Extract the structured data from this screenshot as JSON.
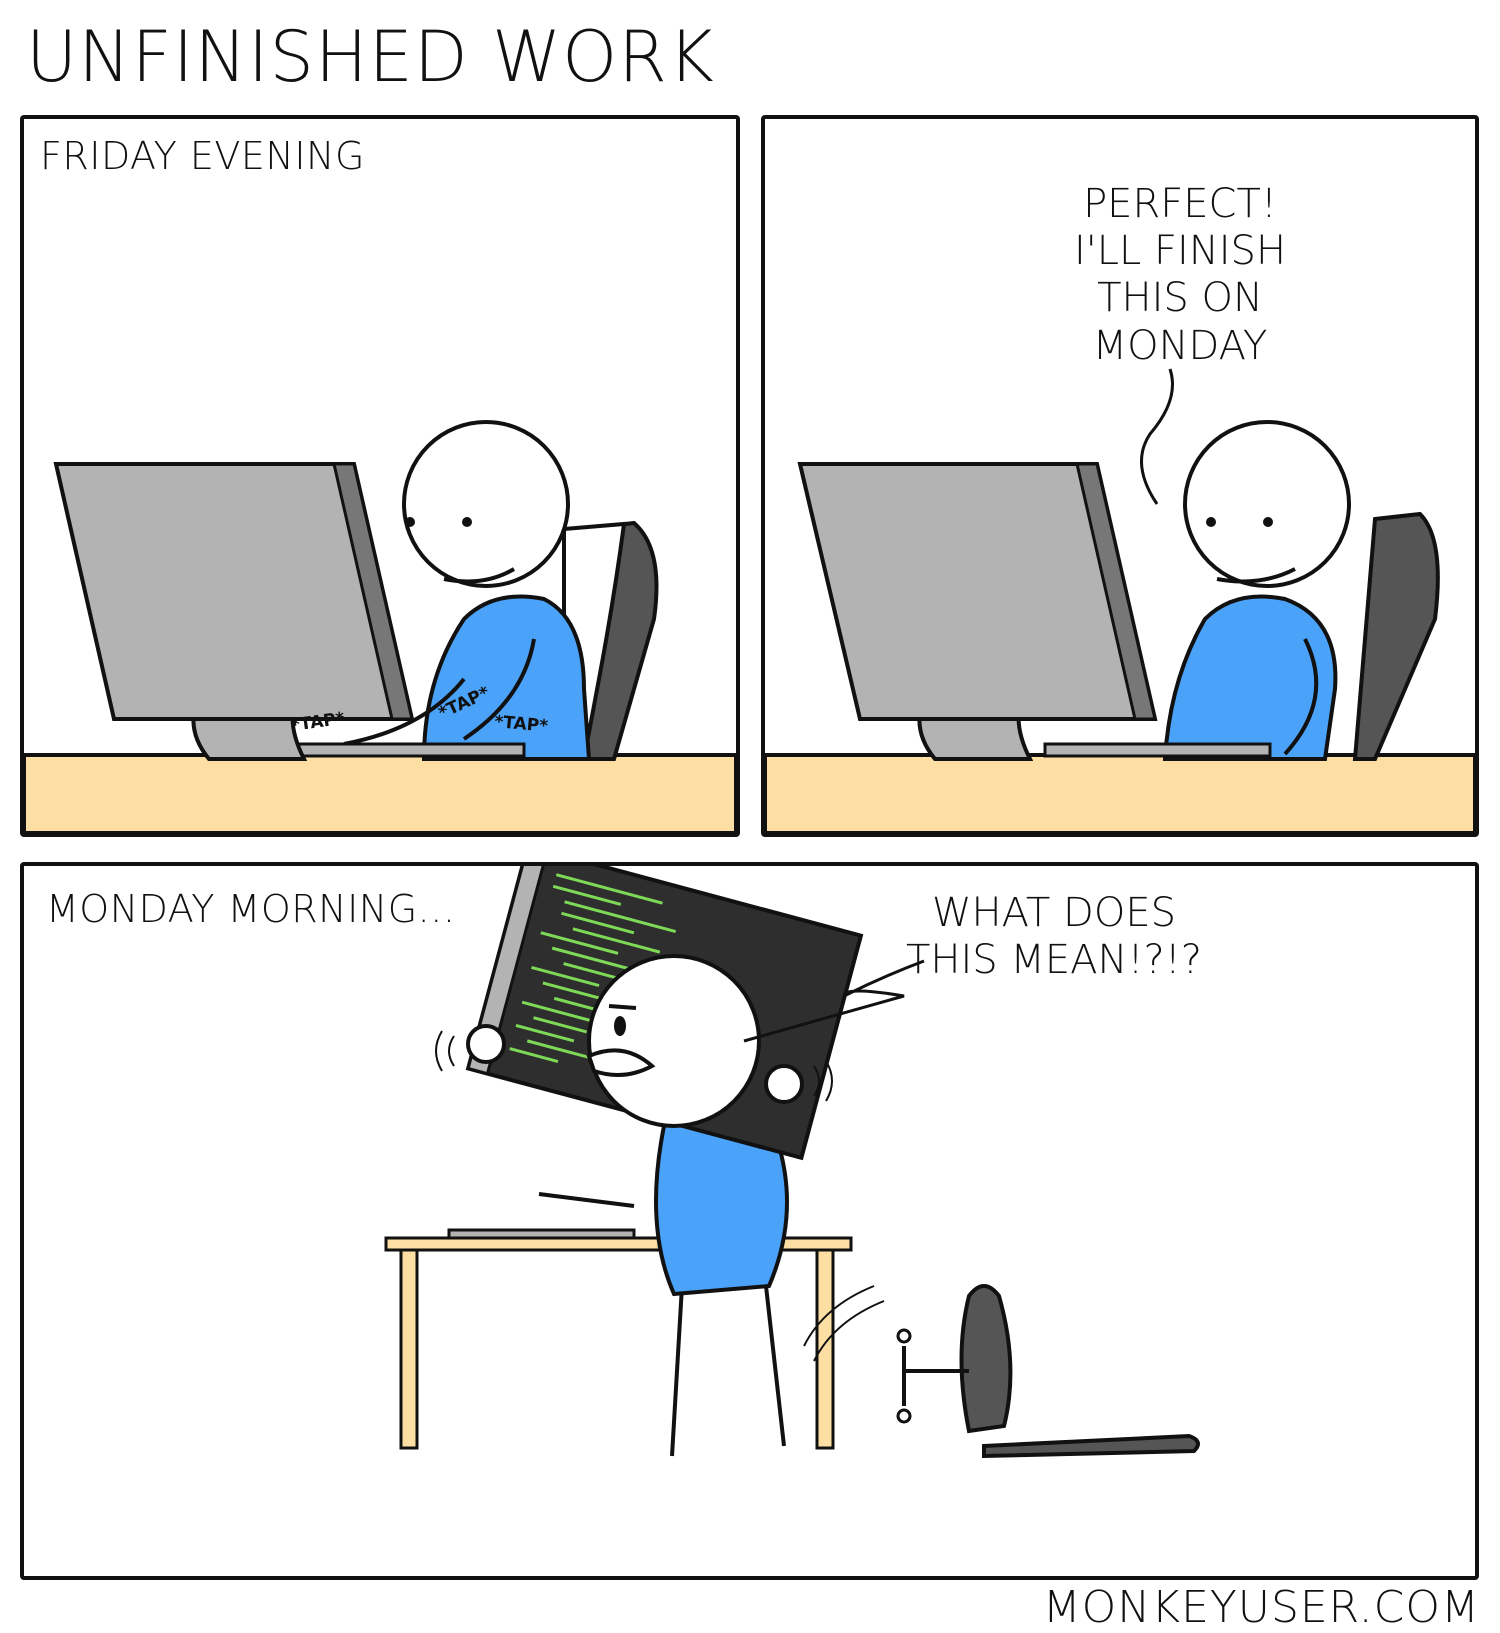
{
  "comic": {
    "title": "UNFINISHED WORK",
    "footer": "MONKEYUSER.COM"
  },
  "panel1": {
    "caption": "FRIDAY EVENING",
    "sfx": [
      "*TAP*",
      "*TAP*",
      "*TAP*"
    ]
  },
  "panel2": {
    "speech_lines": [
      "PERFECT!",
      "I'LL FINISH",
      "THIS ON",
      "MONDAY"
    ]
  },
  "panel3": {
    "caption": "MONDAY MORNING...",
    "speech_lines": [
      "WHAT DOES",
      "THIS MEAN!?!?"
    ]
  },
  "colors": {
    "shirt": "#4BA3F9",
    "desk": "#FDDFA3",
    "monitor": "#B3B3B3",
    "monitor_dark": "#555555",
    "code_green": "#7ED957",
    "screen_dark": "#2E2E2E"
  }
}
